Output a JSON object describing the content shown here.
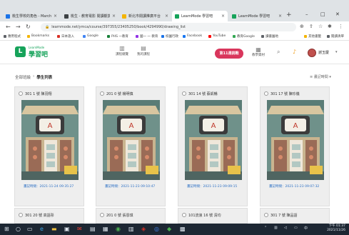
{
  "browser": {
    "tabs": [
      {
        "label": "桃生學校的角色 - March",
        "color": "#1a73e8",
        "active": false
      },
      {
        "label": "桃生 - 教育電影 閱讀觀賞",
        "color": "#3c4043",
        "active": false
      },
      {
        "label": "新北市閱讀推廣平台",
        "color": "#f4b400",
        "active": false
      },
      {
        "label": "LearnMode 學習吧",
        "color": "#16a35a",
        "active": true
      },
      {
        "label": "LearnMode 學習吧",
        "color": "#16a35a",
        "active": false
      }
    ],
    "new_tab": "+",
    "url": "learnmode.net/ymca/course/397355/23405250/book/4294990/drawing_list",
    "bookmarks": [
      {
        "label": "應用程式",
        "color": "#5f6368"
      },
      {
        "label": "Bookmarks",
        "color": "#f4b400"
      },
      {
        "label": "日本語入",
        "color": "#d93025"
      },
      {
        "label": "Google",
        "color": "#4285f4"
      },
      {
        "label": "PHS 一教育",
        "color": "#188038"
      },
      {
        "label": "國一 一 教育",
        "color": "#9334e6"
      },
      {
        "label": "校園行政",
        "color": "#1a73e8"
      },
      {
        "label": "Facebook",
        "color": "#1877f2"
      },
      {
        "label": "YouTube",
        "color": "#ff0000"
      },
      {
        "label": "教育Google",
        "color": "#34a853"
      },
      {
        "label": "讀書園地",
        "color": "#5f6368"
      },
      {
        "label": "其他書籤",
        "color": "#f4b400"
      },
      {
        "label": "閱讀清單",
        "color": "#5f6368"
      }
    ]
  },
  "site": {
    "logo_sub": "LearnMode",
    "logo_text": "學習吧",
    "nav": [
      {
        "label": "課程總覽",
        "icon": "book-icon"
      },
      {
        "label": "我的課程",
        "icon": "folder-icon"
      }
    ],
    "challenge_label": "第11週挑戰",
    "right_items": [
      {
        "label": "教學資材",
        "icon": "grid-icon"
      }
    ],
    "user_name": "謝玉慶"
  },
  "breadcrumb": {
    "parent": "全部班級",
    "separator": "›",
    "current": "學生列表"
  },
  "sort_label": "畫記時間",
  "cards": [
    {
      "title": "301 1 號 陳羽翔",
      "time_label": "畫記時間：2021-11-24 09:35:27"
    },
    {
      "title": "201 0 號 楊明慎",
      "time_label": "畫記時間：2021-11-23 09:10:47"
    },
    {
      "title": "301 14 號 蔡凱暢",
      "time_label": "畫記時間：2021-11-23 09:09:15"
    },
    {
      "title": "301 17 號 陳珍儀",
      "time_label": "畫記時間：2021-11-23 09:07:32"
    }
  ],
  "cards_row2": [
    {
      "title": "301 20 號 高語彤"
    },
    {
      "title": "201 0 號 張恩琪"
    },
    {
      "title": "101流浪 16 號 清均"
    },
    {
      "title": "301 7 號 陳品語"
    }
  ],
  "taskbar": {
    "clock_time": "下午 01:37",
    "clock_date": "2021/11/26"
  }
}
